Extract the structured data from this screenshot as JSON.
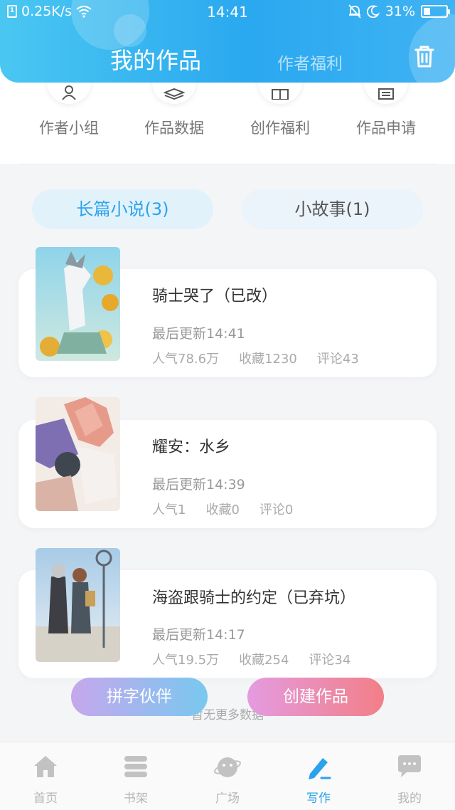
{
  "status_bar": {
    "network_speed": "0.25K/s",
    "time": "14:41",
    "battery": "31%",
    "battery_level": 0.31
  },
  "header": {
    "title": "我的作品",
    "secondary_tab": "作者福利"
  },
  "quick_actions": [
    {
      "label": "作者小组",
      "icon": "people-icon"
    },
    {
      "label": "作品数据",
      "icon": "layers-icon"
    },
    {
      "label": "创作福利",
      "icon": "gift-icon"
    },
    {
      "label": "作品申请",
      "icon": "form-icon"
    }
  ],
  "tabs": [
    {
      "label": "长篇小说(3)",
      "active": true
    },
    {
      "label": "小故事(1)",
      "active": false
    }
  ],
  "works": [
    {
      "title": "骑士哭了（已改）",
      "updated": "最后更新14:41",
      "popularity": "人气78.6万",
      "favorites": "收藏1230",
      "comments": "评论43"
    },
    {
      "title": "耀安：水乡",
      "updated": "最后更新14:39",
      "popularity": "人气1",
      "favorites": "收藏0",
      "comments": "评论0"
    },
    {
      "title": "海盗跟骑士的约定（已弃坑）",
      "updated": "最后更新14:17",
      "popularity": "人气19.5万",
      "favorites": "收藏254",
      "comments": "评论34"
    }
  ],
  "buttons": {
    "partner": "拼字伙伴",
    "create": "创建作品"
  },
  "footer_text": "暂无更多数据",
  "bottom_nav": [
    {
      "label": "首页",
      "icon": "home-icon"
    },
    {
      "label": "书架",
      "icon": "bookshelf-icon"
    },
    {
      "label": "广场",
      "icon": "planet-icon"
    },
    {
      "label": "写作",
      "icon": "pen-icon",
      "active": true
    },
    {
      "label": "我的",
      "icon": "chat-bubble-icon"
    }
  ],
  "colors": {
    "accent": "#2aa2ec",
    "header_start": "#4ac7f1",
    "header_end": "#2aa8f0"
  }
}
